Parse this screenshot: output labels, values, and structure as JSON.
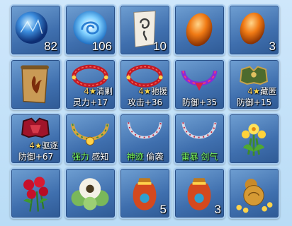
{
  "inventory": {
    "rows": [
      [
        {
          "icon": "blue-crystal-orb-icon",
          "qty": "82"
        },
        {
          "icon": "swirl-orb-icon",
          "qty": "106"
        },
        {
          "icon": "paper-talisman-icon",
          "qty": "10"
        },
        {
          "icon": "orange-egg-icon",
          "qty": ""
        },
        {
          "icon": "orange-egg-icon",
          "qty": "3"
        }
      ],
      [
        {
          "icon": "flame-scroll-icon"
        },
        {
          "icon": "red-bracelet-icon",
          "tag_num": "4",
          "tag_star": "★",
          "tag_name": "清剿",
          "stat": "灵力+17"
        },
        {
          "icon": "red-bracelet-icon",
          "tag_num": "4",
          "tag_star": "★",
          "tag_name": "驰援",
          "stat": "攻击+36"
        },
        {
          "icon": "purple-necklace-icon",
          "stat": "防御+35"
        },
        {
          "icon": "green-armor-icon",
          "tag_num": "4",
          "tag_star": "★",
          "tag_name": "藏匿",
          "stat": "防御+15"
        }
      ],
      [
        {
          "icon": "red-armor-icon",
          "tag_num": "4",
          "tag_star": "★",
          "tag_name": "驱逐",
          "stat": "防御+67"
        },
        {
          "icon": "gold-necklace-icon",
          "stat_a": "强力",
          "stat_b": "感知"
        },
        {
          "icon": "silver-necklace-icon",
          "stat_a": "神迹",
          "stat_b": "偷袭"
        },
        {
          "icon": "silver-necklace-icon",
          "stat_a": "雷暴",
          "stat_b": "剑气"
        },
        {
          "icon": "yellow-flower-icon"
        }
      ],
      [
        {
          "icon": "red-roses-icon"
        },
        {
          "icon": "white-flower-icon"
        },
        {
          "icon": "lucky-bag-icon",
          "qty": "5"
        },
        {
          "icon": "lucky-bag-icon",
          "qty": "3"
        },
        {
          "icon": "gourd-coins-icon"
        }
      ]
    ]
  },
  "colors": {
    "slot": "#3f6fae",
    "background": "#c4e1f8",
    "star": "#ffd94a",
    "green_text": "#7cff5c"
  }
}
